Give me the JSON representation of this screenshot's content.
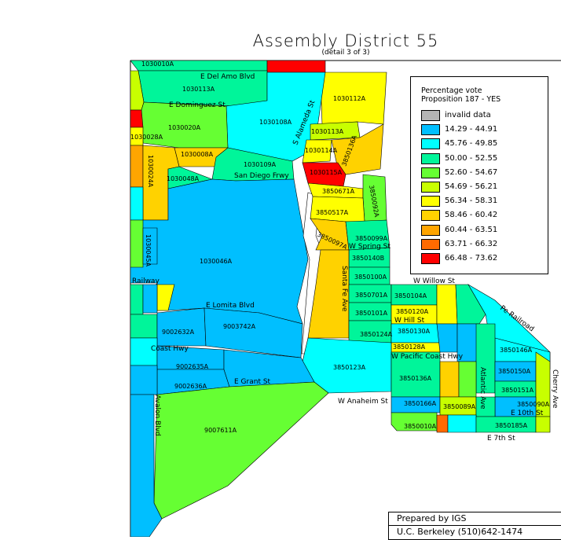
{
  "title": "Assembly District 55",
  "subtitle": "(detail 3 of 3)",
  "legend": {
    "title_line1": "Percentage vote",
    "title_line2": "Proposition 187 - YES",
    "items": [
      {
        "label": "invalid data",
        "color": "#b4b4b4"
      },
      {
        "label": "14.29 - 44.91",
        "color": "#00bfff"
      },
      {
        "label": "45.76 - 49.85",
        "color": "#00ffff"
      },
      {
        "label": "50.00 - 52.55",
        "color": "#00f59a"
      },
      {
        "label": "52.60 - 54.67",
        "color": "#66ff33"
      },
      {
        "label": "54.69 - 56.21",
        "color": "#c8ff00"
      },
      {
        "label": "56.34 - 58.31",
        "color": "#ffff00"
      },
      {
        "label": "58.46 - 60.42",
        "color": "#ffd200"
      },
      {
        "label": "60.44 - 63.51",
        "color": "#ffa500"
      },
      {
        "label": "63.71 - 66.32",
        "color": "#ff6a00"
      },
      {
        "label": "66.48 - 73.62",
        "color": "#ff0000"
      }
    ]
  },
  "credit": {
    "line1": "Prepared by IGS",
    "line2": "U.C. Berkeley (510)642-1474"
  },
  "streets": {
    "del_amo": "E Del Amo Blvd",
    "dominguez": "E Dominguez St",
    "alameda": "S Alameda St",
    "san_diego": "San Diego Frwy",
    "spring": "W Spring St",
    "willow": "W Willow St",
    "hill": "W Hill St",
    "santa_fe": "Santa Fe Ave",
    "lomita": "E Lomita Blvd",
    "pacific": "W Pacific Coast Hwy",
    "coast": "Coast Hwy",
    "grant": "E Grant St",
    "anaheim": "W Anaheim St",
    "pe_railroad": "Pe Railroad",
    "railway": "Railway",
    "atlantic": "Atlantic Ave",
    "cherry": "Cherry Ave",
    "tenth": "E 10th St",
    "seventh": "E 7th St",
    "avalon": "Avalon Blvd"
  },
  "precincts": [
    {
      "id": "1030010A",
      "color": "#00f59a"
    },
    {
      "id": "1030113A",
      "color": "#00f59a"
    },
    {
      "id": "1030112A",
      "color": "#ffff00"
    },
    {
      "id": "1030108A",
      "color": "#00ffff"
    },
    {
      "id": "1030020A",
      "color": "#66ff33"
    },
    {
      "id": "1030028A",
      "color": "#ffff00"
    },
    {
      "id": "1030008A",
      "color": "#ffd200"
    },
    {
      "id": "1030109A",
      "color": "#00f59a"
    },
    {
      "id": "1030113A",
      "color": "#c8ff00"
    },
    {
      "id": "1030114A",
      "color": "#ffff00"
    },
    {
      "id": "3850136A",
      "color": "#ffd200"
    },
    {
      "id": "1030115A",
      "color": "#ff0000"
    },
    {
      "id": "1030048A",
      "color": "#00f59a"
    },
    {
      "id": "1030024A",
      "color": "#ffd200"
    },
    {
      "id": "3850671A",
      "color": "#ffff00"
    },
    {
      "id": "3850517A",
      "color": "#ffff00"
    },
    {
      "id": "3850092A",
      "color": "#66ff33"
    },
    {
      "id": "3850097A",
      "color": "#ffd200"
    },
    {
      "id": "3850099A",
      "color": "#00f59a"
    },
    {
      "id": "3850140B",
      "color": "#00f59a"
    },
    {
      "id": "3850100A",
      "color": "#00f59a"
    },
    {
      "id": "1030046A",
      "color": "#00bfff"
    },
    {
      "id": "1030045A",
      "color": "#00bfff"
    },
    {
      "id": "3850104A",
      "color": "#00f59a"
    },
    {
      "id": "3850701A",
      "color": "#00f59a"
    },
    {
      "id": "3850101A",
      "color": "#00f59a"
    },
    {
      "id": "3850120A",
      "color": "#ffff00"
    },
    {
      "id": "3850130A",
      "color": "#00ffff"
    },
    {
      "id": "3850124A",
      "color": "#00f59a"
    },
    {
      "id": "3850128A",
      "color": "#ffff00"
    },
    {
      "id": "3850123A",
      "color": "#00ffff"
    },
    {
      "id": "3850136A",
      "color": "#00f59a"
    },
    {
      "id": "3850166A",
      "color": "#00bfff"
    },
    {
      "id": "3850089A",
      "color": "#c8ff00"
    },
    {
      "id": "3850010A",
      "color": "#66ff33"
    },
    {
      "id": "3850185A",
      "color": "#00f59a"
    },
    {
      "id": "3850146A",
      "color": "#00ffff"
    },
    {
      "id": "3850150A",
      "color": "#00bfff"
    },
    {
      "id": "3850151A",
      "color": "#00f59a"
    },
    {
      "id": "3850090A",
      "color": "#00bfff"
    },
    {
      "id": "9002632A",
      "color": "#00bfff"
    },
    {
      "id": "9003742A",
      "color": "#00bfff"
    },
    {
      "id": "9002635A",
      "color": "#00bfff"
    },
    {
      "id": "9002636A",
      "color": "#00bfff"
    },
    {
      "id": "9007611A",
      "color": "#66ff33"
    }
  ]
}
